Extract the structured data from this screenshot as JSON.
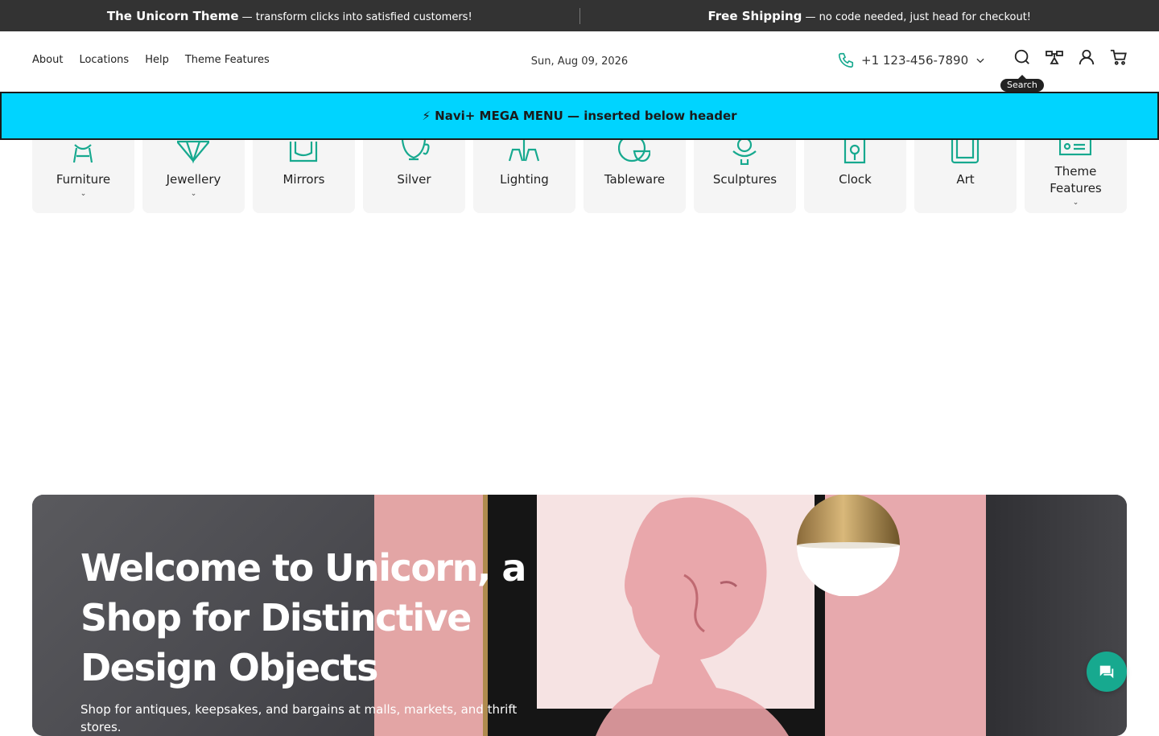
{
  "announcement": {
    "left": {
      "bold": "The Unicorn Theme",
      "text": " — transform clicks into satisfied customers!"
    },
    "right": {
      "bold": "Free Shipping",
      "text": " — no code needed, just head for checkout!"
    }
  },
  "header": {
    "nav": [
      "About",
      "Locations",
      "Help",
      "Theme Features"
    ],
    "date": "Sun, Aug 09, 2026",
    "phone": "+1 123-456-7890",
    "icons": [
      "search-icon",
      "compare-icon",
      "account-icon",
      "cart-icon"
    ],
    "tooltip": "Search"
  },
  "mega_banner": "⚡ Navi+ MEGA MENU — inserted below header",
  "categories": [
    {
      "label": "Furniture",
      "icon": "chair-icon",
      "has_dropdown": true
    },
    {
      "label": "Jewellery",
      "icon": "diamond-icon",
      "has_dropdown": true
    },
    {
      "label": "Mirrors",
      "icon": "mirror-icon",
      "has_dropdown": false
    },
    {
      "label": "Silver",
      "icon": "teapot-icon",
      "has_dropdown": false
    },
    {
      "label": "Lighting",
      "icon": "lamp-icon",
      "has_dropdown": false
    },
    {
      "label": "Tableware",
      "icon": "plates-icon",
      "has_dropdown": false
    },
    {
      "label": "Sculptures",
      "icon": "bust-icon",
      "has_dropdown": false
    },
    {
      "label": "Clock",
      "icon": "clock-icon",
      "has_dropdown": false
    },
    {
      "label": "Art",
      "icon": "frame-icon",
      "has_dropdown": false
    },
    {
      "label": "Theme Features",
      "icon": "features-icon",
      "has_dropdown": true
    }
  ],
  "hero": {
    "title": "Welcome to Unicorn, a Shop for Distinctive Design Objects",
    "subtitle": "Shop for antiques, keepsakes, and bargains at malls, markets, and thrift stores."
  },
  "colors": {
    "accent": "#17a98f",
    "announce_bg": "#333333",
    "mega_bg": "#00d4ff"
  },
  "chat_icon": "chat-icon"
}
